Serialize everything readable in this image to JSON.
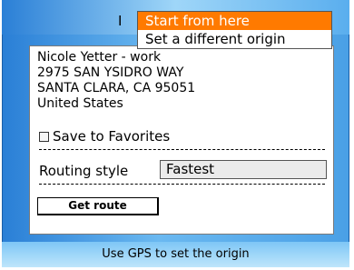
{
  "header": {
    "title_partial": "I"
  },
  "address": {
    "name": "Nicole Yetter - work",
    "street": "2975 SAN YSIDRO WAY",
    "city_line": "SANTA CLARA, CA 95051",
    "country": "United States"
  },
  "favorites": {
    "label": "Save to Favorites",
    "checked": false
  },
  "routing": {
    "label": "Routing style",
    "value": "Fastest"
  },
  "actions": {
    "get_route": "Get route"
  },
  "status_bar": {
    "text": "Use GPS to set the origin"
  },
  "menu": {
    "items": [
      {
        "label": "Start from here",
        "selected": true
      },
      {
        "label": "Set a different origin",
        "selected": false
      }
    ]
  },
  "colors": {
    "menu_highlight": "#ff7a00",
    "frame_blue": "#2a7fd6"
  }
}
